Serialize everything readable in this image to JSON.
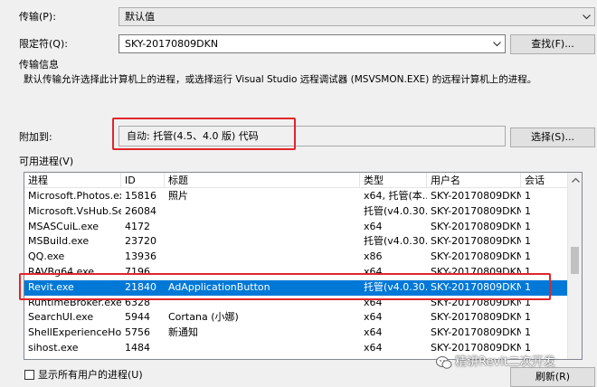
{
  "transport": {
    "label": "传输(P):",
    "value": "默认值"
  },
  "qualifier": {
    "label": "限定符(Q):",
    "value": "SKY-20170809DKN",
    "find_button": "查找(F)..."
  },
  "transport_info": {
    "title": "传输信息",
    "description": "默认传输允许选择此计算机上的进程，或选择运行 Visual Studio 远程调试器 (MSVSMON.EXE) 的远程计算机上的进程。"
  },
  "attach_to": {
    "label": "附加到:",
    "value": "自动: 托管(4.5、4.0 版) 代码",
    "select_button": "选择(S)..."
  },
  "available_processes": {
    "label": "可用进程(V)",
    "columns": [
      "进程",
      "ID",
      "标题",
      "类型",
      "用户名",
      "会话"
    ],
    "rows": [
      [
        "Microsoft.Photos.exe",
        "15816",
        "照片",
        "x64, 托管(本...",
        "SKY-20170809DKN...",
        "1"
      ],
      [
        "Microsoft.VsHub.Se...",
        "26084",
        "",
        "托管(v4.0.30...",
        "SKY-20170809DKN...",
        "1"
      ],
      [
        "MSASCuiL.exe",
        "4172",
        "",
        "x64",
        "SKY-20170809DKN...",
        "1"
      ],
      [
        "MSBuild.exe",
        "23720",
        "",
        "托管(v4.0.30...",
        "SKY-20170809DKN...",
        "1"
      ],
      [
        "QQ.exe",
        "13936",
        "",
        "x86",
        "SKY-20170809DKN...",
        "1"
      ],
      [
        "RAVBg64.exe",
        "7196",
        "",
        "x64",
        "SKY-20170809DKN...",
        "1"
      ],
      [
        "Revit.exe",
        "21840",
        "AdApplicationButton",
        "托管(v4.0.30...",
        "SKY-20170809DKN...",
        "1"
      ],
      [
        "RuntimeBroker.exe",
        "6328",
        "",
        "x64",
        "SKY-20170809DKN...",
        "1"
      ],
      [
        "SearchUI.exe",
        "5944",
        "Cortana (小娜)",
        "x64",
        "SKY-20170809DKN...",
        "1"
      ],
      [
        "ShellExperienceHos...",
        "5756",
        "新通知",
        "x64",
        "SKY-20170809DKN...",
        "1"
      ],
      [
        "sihost.exe",
        "1484",
        "",
        "x64",
        "SKY-20170809DKN...",
        "1"
      ]
    ],
    "selected_process": "Revit.exe"
  },
  "show_all_users": {
    "label": "显示所有用户的进程(U)",
    "checked": false
  },
  "refresh_button": "刷新(R)",
  "watermark": "精讲Revit二次开发",
  "colors": {
    "highlight_box": "#e0262b",
    "selection": "#0078d7"
  }
}
